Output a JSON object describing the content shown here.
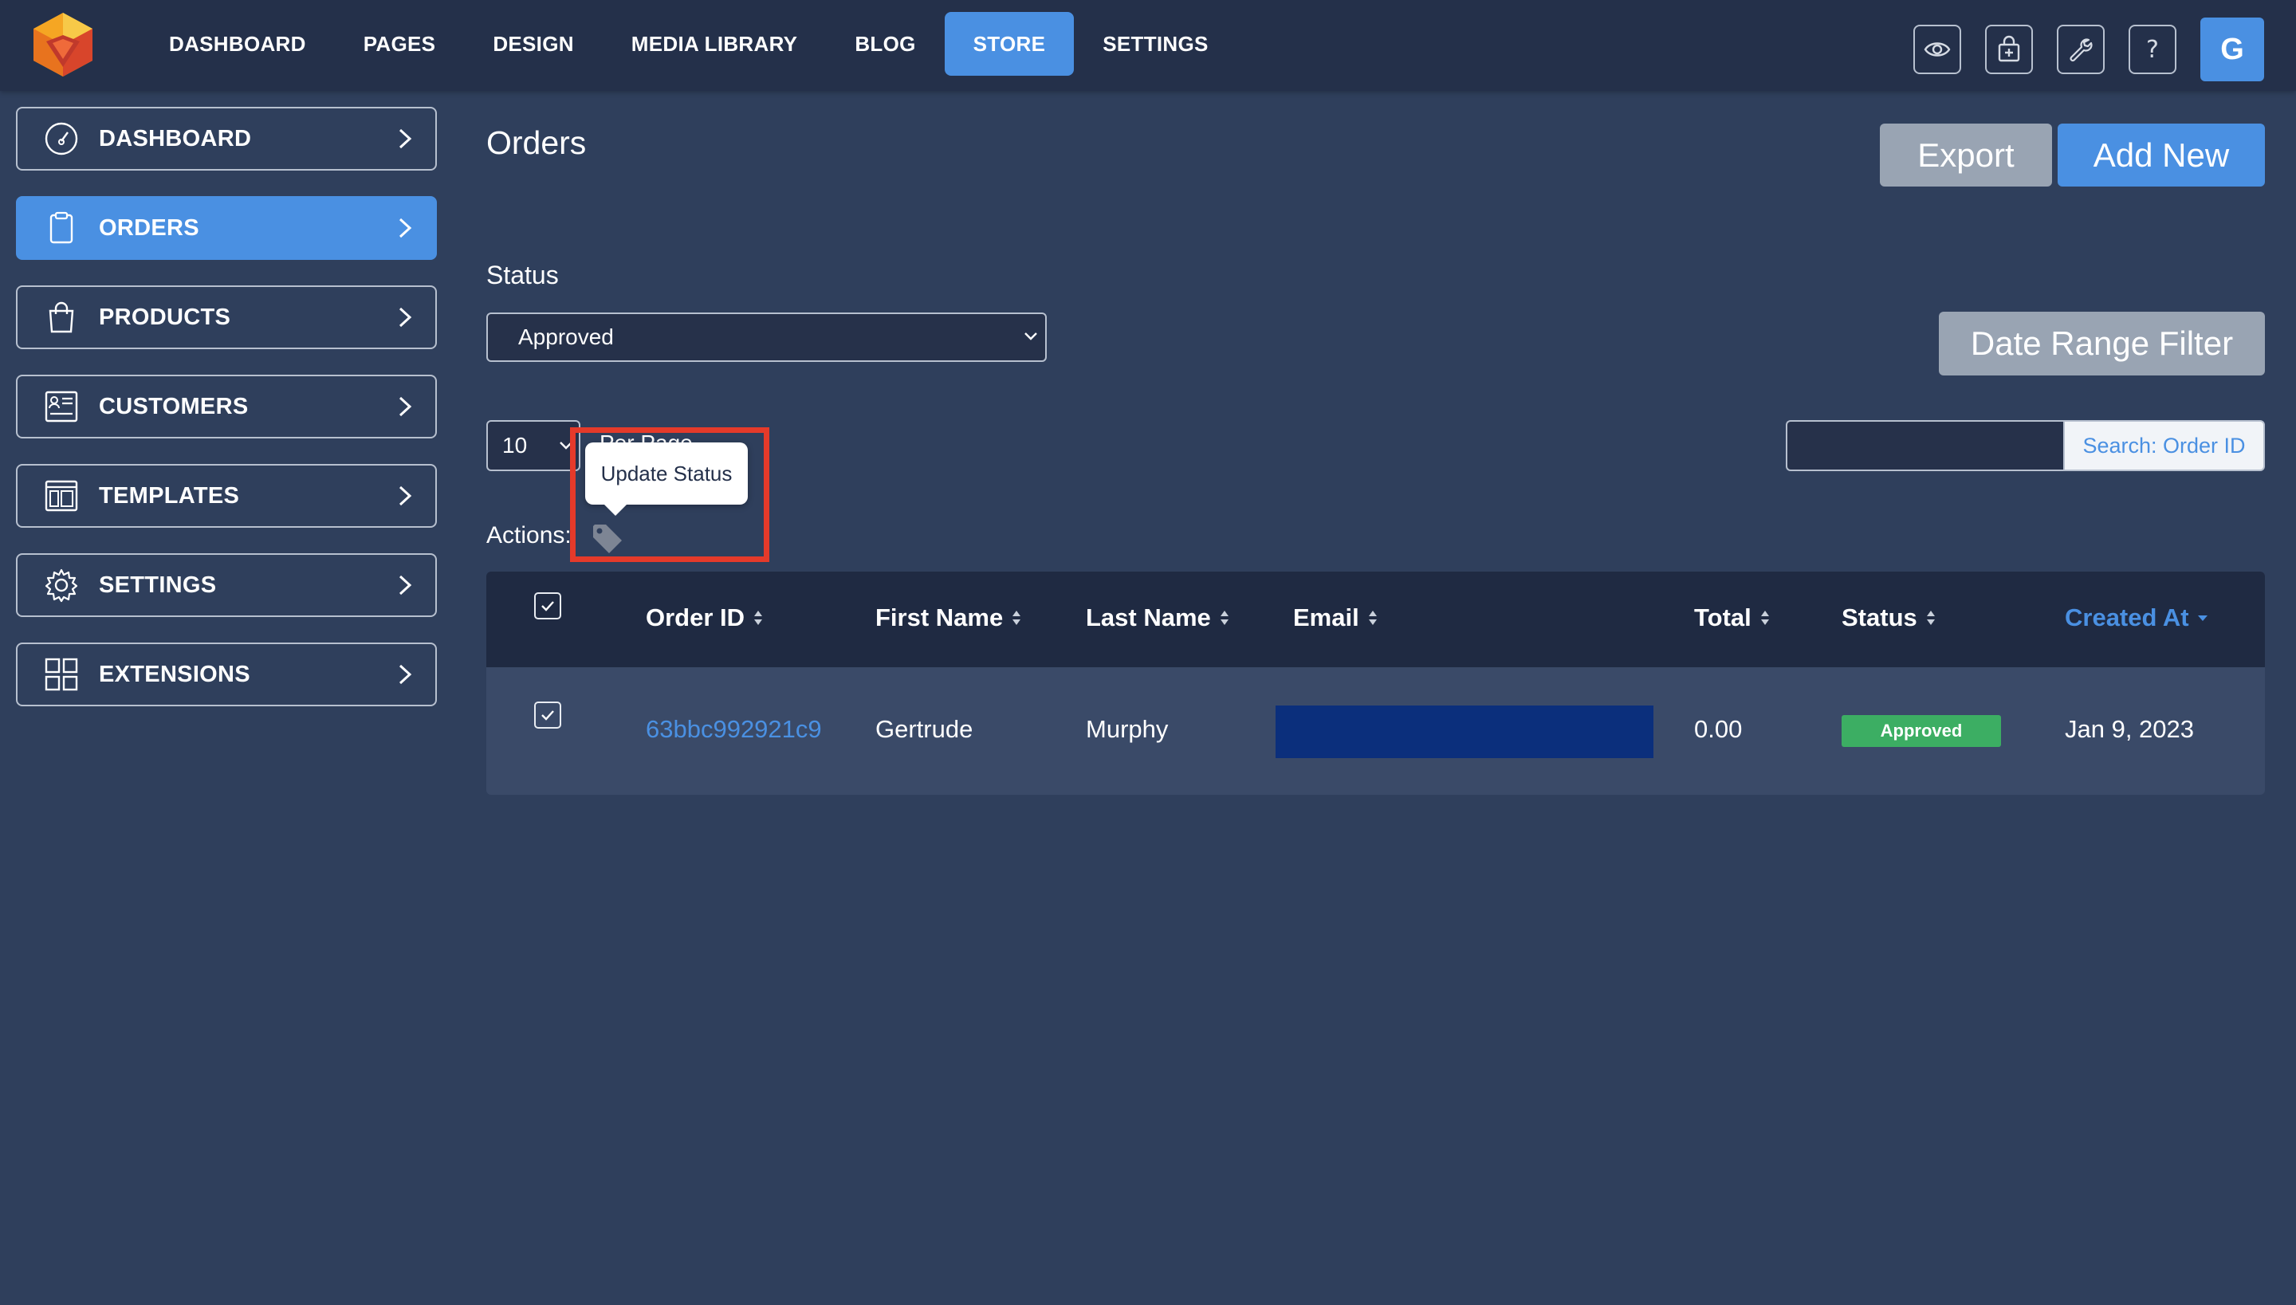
{
  "topnav": {
    "items": [
      {
        "label": "DASHBOARD"
      },
      {
        "label": "PAGES"
      },
      {
        "label": "DESIGN"
      },
      {
        "label": "MEDIA LIBRARY"
      },
      {
        "label": "BLOG"
      },
      {
        "label": "STORE",
        "active": true
      },
      {
        "label": "SETTINGS"
      }
    ],
    "icons": [
      "eye-icon",
      "shopping-bag-icon",
      "wrench-icon",
      "help-icon"
    ],
    "avatar_initial": "G"
  },
  "sidebar": {
    "items": [
      {
        "label": "DASHBOARD",
        "icon": "gauge-icon"
      },
      {
        "label": "ORDERS",
        "icon": "clipboard-icon",
        "active": true
      },
      {
        "label": "PRODUCTS",
        "icon": "shopping-bag-icon"
      },
      {
        "label": "CUSTOMERS",
        "icon": "address-card-icon"
      },
      {
        "label": "TEMPLATES",
        "icon": "layout-icon"
      },
      {
        "label": "SETTINGS",
        "icon": "gear-icon"
      },
      {
        "label": "EXTENSIONS",
        "icon": "grid-icon"
      }
    ]
  },
  "main": {
    "title": "Orders",
    "export_label": "Export",
    "add_new_label": "Add New",
    "status_label": "Status",
    "status_value": "Approved",
    "date_range_label": "Date Range Filter",
    "per_page_value": "10",
    "per_page_label": "Per Page",
    "search_button": "Search: Order ID",
    "search_value": "",
    "actions_label": "Actions:",
    "tooltip": "Update Status"
  },
  "table": {
    "columns": [
      "Order ID",
      "First Name",
      "Last Name",
      "Email",
      "Total",
      "Status",
      "Created At"
    ],
    "sorted_column": "Created At",
    "rows": [
      {
        "order_id": "63bbc992921c9",
        "first_name": "Gertrude",
        "last_name": "Murphy",
        "email": "",
        "total": "0.00",
        "status": "Approved",
        "created_at": "Jan 9, 2023",
        "checked": true
      }
    ]
  },
  "colors": {
    "accent": "#4a90e2",
    "background": "#2f3f5c",
    "topbar": "#24304a",
    "approved": "#3cae63",
    "highlight": "#e53a2a"
  }
}
